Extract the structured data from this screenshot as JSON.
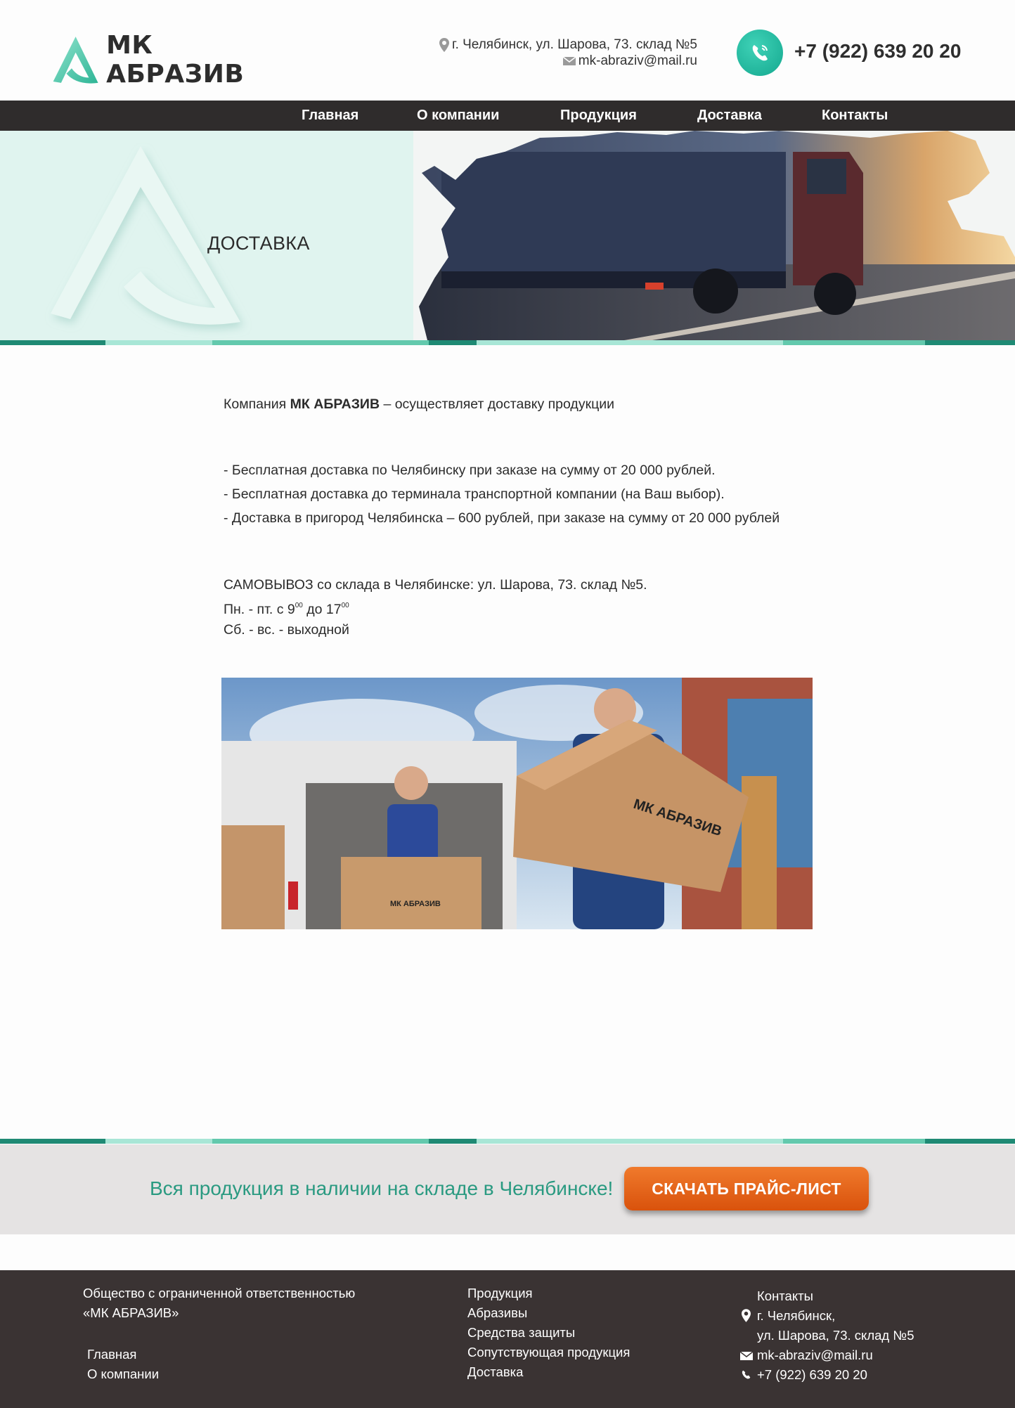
{
  "header": {
    "brand": "МК АБРАЗИВ",
    "address": "г. Челябинск, ул. Шарова, 73. склад №5",
    "email": "mk-abraziv@mail.ru",
    "phone": "+7 (922) 639 20 20"
  },
  "nav": {
    "items": [
      {
        "label": "Главная"
      },
      {
        "label": "О компании"
      },
      {
        "label": "Продукция"
      },
      {
        "label": "Доставка"
      },
      {
        "label": "Контакты"
      }
    ]
  },
  "hero": {
    "title": "ДОСТАВКА"
  },
  "content": {
    "intro_prefix": "Компания",
    "intro_brand": "МК АБРАЗИВ",
    "intro_suffix": "– осуществляет доставку продукции",
    "terms": [
      "- Бесплатная доставка по Челябинску при заказе на сумму от 20 000 рублей.",
      "- Бесплатная доставка до терминала транспортной компании (на Ваш выбор).",
      "- Доставка в пригород Челябинска – 600 рублей, при заказе на сумму от 20 000 рублей"
    ],
    "pickup": "САМОВЫВОЗ со склада в Челябинске:  ул. Шарова, 73. склад №5.",
    "hours_prefix": "Пн. - пт.  с 9",
    "hours_sup1": "00",
    "hours_mid": " до 17",
    "hours_sup2": "00",
    "weekend": "Сб. - вс. - выходной",
    "box_label": "МК АБРАЗИВ"
  },
  "banner": {
    "text": "Вся продукция в наличии на складе в Челябинске!",
    "button": "СКАЧАТЬ ПРАЙС-ЛИСТ"
  },
  "footer": {
    "company_line1": "Общество с ограниченной ответственностью",
    "company_line2": "«МК АБРАЗИВ»",
    "links_left": [
      "Главная",
      "О компании"
    ],
    "links_mid": [
      "Продукция",
      "Абразивы",
      "Средства защиты",
      "Сопутствующая продукция",
      "Доставка"
    ],
    "contacts_title": "Контакты",
    "city": "г. Челябинск,",
    "street": "ул. Шарова, 73. склад №5",
    "email": "mk-abraziv@mail.ru",
    "phone": "+7 (922) 639 20 20"
  },
  "colors": {
    "accent": "#2a9a81",
    "teal_dark": "#1f8a74",
    "teal_light": "#a8e6d6",
    "nav_bg": "#2f2c2c",
    "button": "#e8641c",
    "footer_bg": "#3a3333"
  }
}
